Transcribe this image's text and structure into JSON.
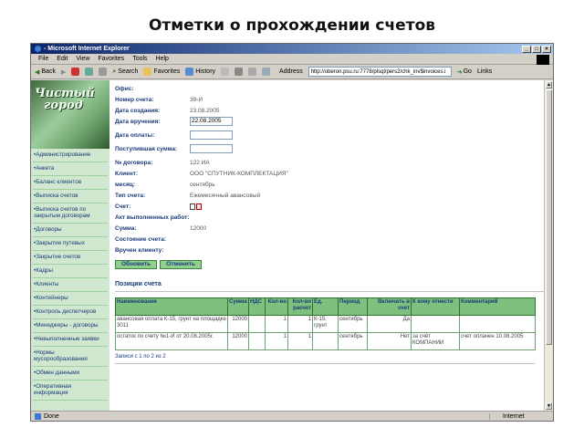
{
  "slide_title": "Отметки о прохождении счетов",
  "window": {
    "title": "- Microsoft Internet Explorer",
    "menu": [
      "File",
      "Edit",
      "View",
      "Favorites",
      "Tools",
      "Help"
    ],
    "toolbar": {
      "back": "Back",
      "search": "Search",
      "favorites": "Favorites",
      "history": "History",
      "address_label": "Address",
      "address_value": "http://oberon.psu.ru:7778/plsql/pers2/chk_inv$invoices.i",
      "go": "Go",
      "links": "Links"
    },
    "status": {
      "left": "Done",
      "zone": "Internet"
    }
  },
  "sidebar": {
    "logo_line1": "Чистый",
    "logo_line2": "город",
    "items": [
      "•Администрирование",
      "•Анкета",
      "•Баланс клиентов",
      "•Выписка счетов",
      "•Выписка счетов по закрытым договорам",
      "•Договоры",
      "•Закрытие путевых",
      "•Закрытие счетов",
      "•Кадры",
      "•Клиенты",
      "•Контейнеры",
      "•Контроль диспетчеров",
      "•Менеджеры - договоры",
      "•Невыполненные заявки",
      "•Нормы мусорообразования",
      "•Обмен данными",
      "•Оперативная информация"
    ]
  },
  "form": {
    "office_label": "Офис:",
    "office_value": "",
    "invoice_no_label": "Номер счета:",
    "invoice_no_value": "39-И",
    "created_label": "Дата создания:",
    "created_value": "23.08.2005",
    "delivered_label": "Дата вручения:",
    "delivered_value": "22.08.2005",
    "paid_label": "Дата оплаты:",
    "paid_value": "",
    "received_label": "Поступившая сумма:",
    "received_value": "",
    "contract_label": "№ договора:",
    "contract_value": "122 ИА",
    "client_label": "Клиент:",
    "client_value": "ООО \"СПУТНИК-КОМПЛЕКТАЦИЯ\"",
    "month_label": "месяц:",
    "month_value": "сентябрь",
    "type_label": "Тип счета:",
    "type_value": "Ежемесячный авансовый",
    "account_label": "Счет:",
    "act_label": "Акт выполненных работ:",
    "sum_label": "Сумма:",
    "sum_value": "12000",
    "state_label": "Состояние счета:",
    "handed_label": "Вручен клиенту:",
    "btn_refresh": "Обновить",
    "btn_cancel": "Отменить"
  },
  "positions": {
    "title": "Позиции счета",
    "headers": [
      "Наименование",
      "Сумма",
      "НДС",
      "Кол-во",
      "Кол-во расчет",
      "Ед.",
      "Период",
      "Включать в счет",
      "К кому отнести",
      "Комментарий"
    ],
    "rows": [
      [
        "авансовая оплата К-15, грунт на площадке 3011",
        "12000",
        "",
        "1",
        "1",
        "К-15, грунт",
        "сентябрь",
        "Да",
        "",
        ""
      ],
      [
        "остаток по счету №1-И от 20.08.2005г.",
        "12000",
        "",
        "1",
        "1",
        "",
        "сентябрь",
        "Нет",
        "за счёт КОМПАНИИ",
        "счет оплачен 10.08.2005"
      ]
    ],
    "records": "Записи с 1 по 2 из 2"
  }
}
